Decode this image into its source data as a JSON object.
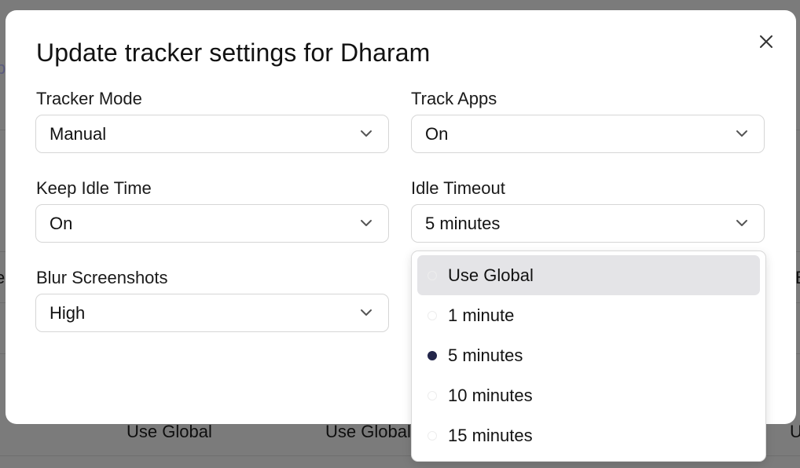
{
  "background": {
    "row_cells": [
      "Use Global",
      "Use Global"
    ],
    "fragments": [
      "p",
      "e",
      "B",
      "U"
    ]
  },
  "modal": {
    "title": "Update tracker settings for Dharam",
    "close_icon": "close-icon",
    "fields": [
      {
        "label": "Tracker Mode",
        "value": "Manual"
      },
      {
        "label": "Track Apps",
        "value": "On"
      },
      {
        "label": "Keep Idle Time",
        "value": "On"
      },
      {
        "label": "Idle Timeout",
        "value": "5 minutes"
      },
      {
        "label": "Blur Screenshots",
        "value": "High"
      }
    ]
  },
  "idle_timeout_dropdown": {
    "options": [
      "Use Global",
      "1 minute",
      "5 minutes",
      "10 minutes",
      "15 minutes"
    ],
    "highlighted": "Use Global",
    "selected": "5 minutes"
  },
  "colors": {
    "overlay": "#7b7b7b",
    "selected_dot": "#23264a",
    "highlight": "#e4e4e7"
  }
}
